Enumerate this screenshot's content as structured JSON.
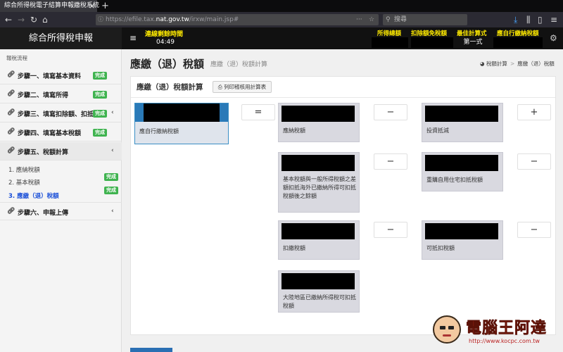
{
  "browser": {
    "tab_title": "綜合所得稅電子結算申報繳稅系統",
    "tab_close": "×",
    "new_tab": "+",
    "url_prefix": "https://efile.tax.",
    "url_host": "nat.gov.tw",
    "url_path": "/irxw/main.jsp#",
    "search_placeholder": "搜尋"
  },
  "header": {
    "app_title": "綜合所得稅申報",
    "menu_icon": "≡",
    "timer_label": "連線剩餘時間",
    "timer_value": "04:49",
    "income_total_label": "所得總額",
    "deduction_label": "扣除額免稅額",
    "best_method_label": "最佳計算式",
    "best_method_value": "第一式",
    "self_pay_label": "應自行繳納稅額"
  },
  "sidebar": {
    "flow_label": "報稅流程",
    "steps": [
      {
        "label": "步驟一、填寫基本資料",
        "badge": "完成"
      },
      {
        "label": "步驟二、填寫所得",
        "badge": "完成"
      },
      {
        "label": "步驟三、填寫扣除額、扣抵",
        "badge": "完成"
      },
      {
        "label": "步驟四、填寫基本稅額",
        "badge": "完成"
      },
      {
        "label": "步驟五、稅額計算"
      },
      {
        "label": "步驟六、申報上傳"
      }
    ],
    "substeps": [
      {
        "label": "1. 應納稅額"
      },
      {
        "label": "2. 基本稅額",
        "badge": "完成"
      },
      {
        "label": "3. 應繳（退）稅額",
        "badge": "完成"
      }
    ]
  },
  "main": {
    "title": "應繳（退）稅額",
    "subtitle": "應繳（退）稅額計算",
    "breadcrumb_home": "稅額計算",
    "breadcrumb_sep": ">",
    "breadcrumb_current": "應繳（退）稅額",
    "panel_title": "應繳（退）稅額計算",
    "print_button": "列印稽核用計算表",
    "cards": {
      "self_pay": "應自行繳納稅額",
      "tax_payable": "應納稅額",
      "investment_credit": "投資抵減",
      "basic_tax_diff": "基本稅額與一般所得稅額之差額扣抵海外已繳納所得可扣抵稅額後之餘額",
      "home_loan_credit": "重購自用住宅扣抵稅額",
      "withheld_tax": "扣繳稅額",
      "creditable_tax": "可抵扣稅額",
      "mainland_tax": "大陸地區已繳納所得稅可扣抵稅額"
    },
    "operators": {
      "equals": "=",
      "minus": "−",
      "plus": "+"
    }
  },
  "watermark": {
    "title": "電腦王阿達",
    "url": "http://www.kocpc.com.tw"
  }
}
